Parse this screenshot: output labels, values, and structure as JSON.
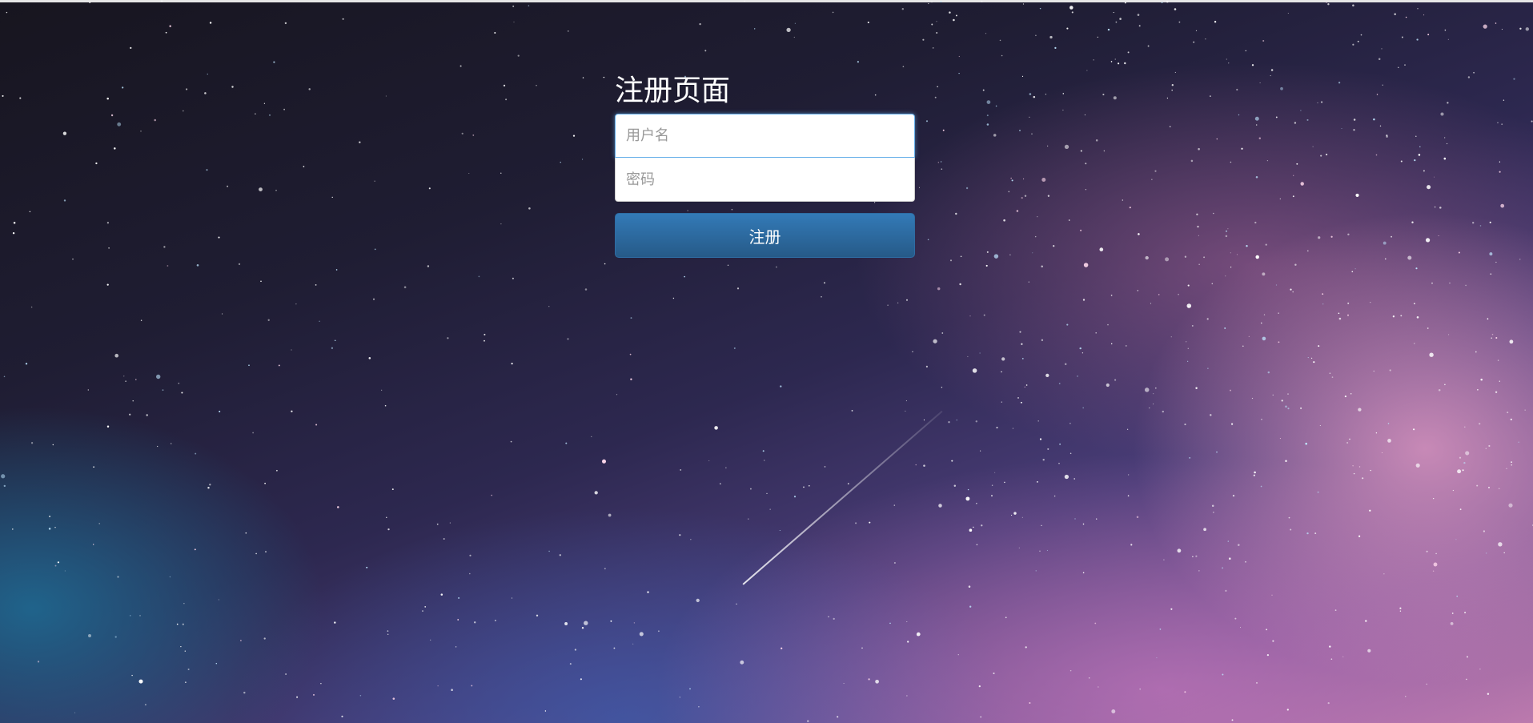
{
  "form": {
    "title": "注册页面",
    "username_placeholder": "用户名",
    "password_placeholder": "密码",
    "submit_label": "注册"
  },
  "colors": {
    "accent": "#337ab7",
    "title_text": "#ffffff",
    "sky_dark": "#17151f",
    "sky_pink": "#b97aaa"
  }
}
